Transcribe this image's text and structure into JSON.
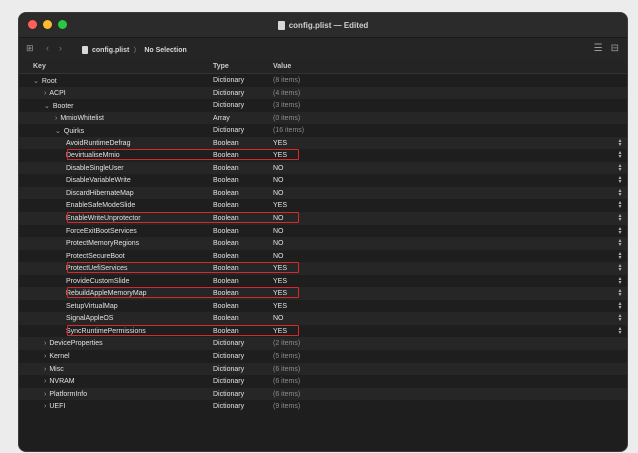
{
  "window": {
    "title": "config.plist — Edited"
  },
  "pathbar": {
    "file": "config.plist",
    "separator": "〉",
    "selection": "No Selection"
  },
  "columns": {
    "key": "Key",
    "type": "Type",
    "value": "Value"
  },
  "colors": {
    "highlight": "#d42a2a",
    "close": "#ff5f57",
    "minimize": "#febc2e",
    "zoom": "#28c840"
  },
  "rows": [
    {
      "key": "Root",
      "type": "Dictionary",
      "value": "(8 items)",
      "depth": 0,
      "disclosure": "open",
      "dim": true
    },
    {
      "key": "ACPI",
      "type": "Dictionary",
      "value": "(4 items)",
      "depth": 1,
      "disclosure": "closed",
      "dim": true
    },
    {
      "key": "Booter",
      "type": "Dictionary",
      "value": "(3 items)",
      "depth": 1,
      "disclosure": "open",
      "dim": true
    },
    {
      "key": "MmioWhitelist",
      "type": "Array",
      "value": "(0 items)",
      "depth": 2,
      "disclosure": "closed",
      "dim": true
    },
    {
      "key": "Quirks",
      "type": "Dictionary",
      "value": "(16 items)",
      "depth": 2,
      "disclosure": "open",
      "dim": true
    },
    {
      "key": "AvoidRuntimeDefrag",
      "type": "Boolean",
      "value": "YES",
      "depth": 3
    },
    {
      "key": "DevirtualiseMmio",
      "type": "Boolean",
      "value": "YES",
      "depth": 3,
      "highlight": true
    },
    {
      "key": "DisableSingleUser",
      "type": "Boolean",
      "value": "NO",
      "depth": 3
    },
    {
      "key": "DisableVariableWrite",
      "type": "Boolean",
      "value": "NO",
      "depth": 3
    },
    {
      "key": "DiscardHibernateMap",
      "type": "Boolean",
      "value": "NO",
      "depth": 3
    },
    {
      "key": "EnableSafeModeSlide",
      "type": "Boolean",
      "value": "YES",
      "depth": 3
    },
    {
      "key": "EnableWriteUnprotector",
      "type": "Boolean",
      "value": "NO",
      "depth": 3,
      "highlight": true
    },
    {
      "key": "ForceExitBootServices",
      "type": "Boolean",
      "value": "NO",
      "depth": 3
    },
    {
      "key": "ProtectMemoryRegions",
      "type": "Boolean",
      "value": "NO",
      "depth": 3
    },
    {
      "key": "ProtectSecureBoot",
      "type": "Boolean",
      "value": "NO",
      "depth": 3
    },
    {
      "key": "ProtectUefiServices",
      "type": "Boolean",
      "value": "YES",
      "depth": 3,
      "highlight": true
    },
    {
      "key": "ProvideCustomSlide",
      "type": "Boolean",
      "value": "YES",
      "depth": 3
    },
    {
      "key": "RebuildAppleMemoryMap",
      "type": "Boolean",
      "value": "YES",
      "depth": 3,
      "highlight": true
    },
    {
      "key": "SetupVirtualMap",
      "type": "Boolean",
      "value": "YES",
      "depth": 3
    },
    {
      "key": "SignalAppleOS",
      "type": "Boolean",
      "value": "NO",
      "depth": 3
    },
    {
      "key": "SyncRuntimePermissions",
      "type": "Boolean",
      "value": "YES",
      "depth": 3,
      "highlight": true
    },
    {
      "key": "DeviceProperties",
      "type": "Dictionary",
      "value": "(2 items)",
      "depth": 1,
      "disclosure": "closed",
      "dim": true
    },
    {
      "key": "Kernel",
      "type": "Dictionary",
      "value": "(5 items)",
      "depth": 1,
      "disclosure": "closed",
      "dim": true
    },
    {
      "key": "Misc",
      "type": "Dictionary",
      "value": "(6 items)",
      "depth": 1,
      "disclosure": "closed",
      "dim": true
    },
    {
      "key": "NVRAM",
      "type": "Dictionary",
      "value": "(6 items)",
      "depth": 1,
      "disclosure": "closed",
      "dim": true
    },
    {
      "key": "PlatformInfo",
      "type": "Dictionary",
      "value": "(6 items)",
      "depth": 1,
      "disclosure": "closed",
      "dim": true
    },
    {
      "key": "UEFI",
      "type": "Dictionary",
      "value": "(9 items)",
      "depth": 1,
      "disclosure": "closed",
      "dim": true
    }
  ]
}
